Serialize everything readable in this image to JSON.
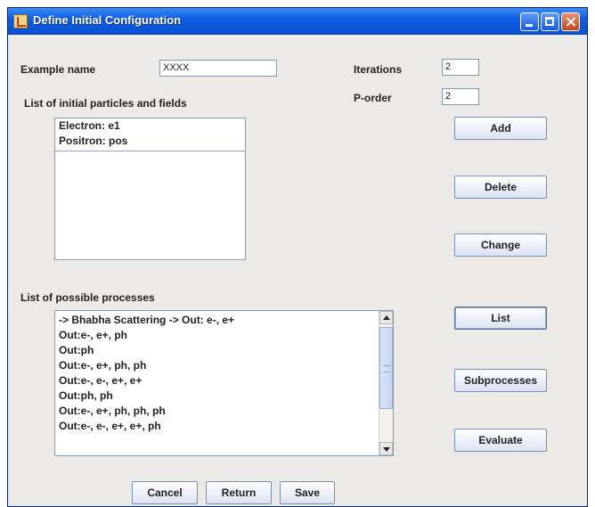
{
  "window": {
    "title": "Define Initial Configuration"
  },
  "form": {
    "example_name_label": "Example name",
    "example_name_value": "XXXX",
    "iterations_label": "Iterations",
    "iterations_value": "2",
    "porder_label": "P-order",
    "porder_value": "2"
  },
  "particles": {
    "heading": "List of initial particles and fields",
    "items": [
      "Electron: e1",
      "Positron: pos"
    ]
  },
  "processes": {
    "heading": "List of possible processes",
    "items": [
      " -> Bhabha Scattering -> Out: e-, e+",
      "Out:e-, e+, ph",
      "Out:ph",
      "Out:e-, e+, ph, ph",
      "Out:e-, e-, e+, e+",
      "Out:ph, ph",
      "Out:e-, e+, ph, ph, ph",
      "Out:e-, e-, e+, e+, ph"
    ]
  },
  "buttons": {
    "add": "Add",
    "delete": "Delete",
    "change": "Change",
    "list": "List",
    "subprocesses": "Subprocesses",
    "evaluate": "Evaluate",
    "cancel": "Cancel",
    "return": "Return",
    "save": "Save"
  }
}
